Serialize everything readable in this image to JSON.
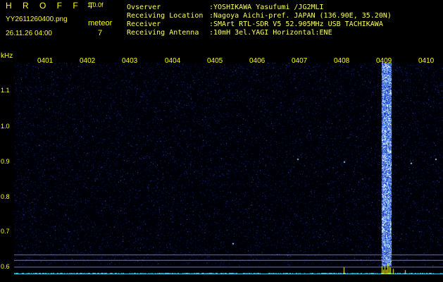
{
  "header": {
    "app_name": "H R O F F T",
    "version": "1.0.0f",
    "file_name": "YY2611260400.png",
    "date": "26.11.26 04:00",
    "meteor_label": "meteor",
    "meteor_count": "7"
  },
  "station_info": [
    {
      "key": "Ovserver",
      "value": ":YOSHIKAWA Yasufumi /JG2MLI"
    },
    {
      "key": "Receiving Location",
      "value": ":Nagoya Aichi-pref. JAPAN (136.90E, 35.20N)"
    },
    {
      "key": "Receiver",
      "value": ":SMArt RTL-SDR V5 52.905MHz USB TACHIKAWA"
    },
    {
      "key": "Receiving Antenna",
      "value": ":10mH 3el.YAGI Horizontal:ENE"
    }
  ],
  "axis": {
    "unit": "kHz",
    "y_ticks": [
      "1.1",
      "1.0",
      "0.9",
      "0.8",
      "0.7",
      "0.6"
    ],
    "x_ticks": [
      "0401",
      "0402",
      "0403",
      "0404",
      "0405",
      "0406",
      "0407",
      "0408",
      "0409",
      "0410"
    ]
  },
  "colors": {
    "background": "#000000",
    "noise": "#1a2aa0",
    "signal": "#66aaff",
    "bright": "#ffffff",
    "text": "#ffff00",
    "baseline": "#33ddff"
  }
}
